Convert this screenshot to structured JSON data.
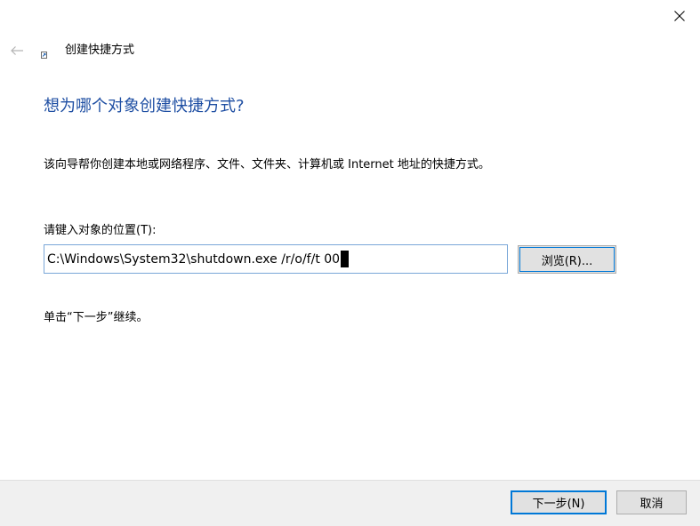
{
  "window": {
    "close_icon": "close-icon"
  },
  "header": {
    "back_icon": "back-arrow-icon",
    "wizard_icon": "shortcut-icon",
    "title": "创建快捷方式"
  },
  "main": {
    "heading": "想为哪个对象创建快捷方式?",
    "description": "该向导帮你创建本地或网络程序、文件、文件夹、计算机或 Internet 地址的快捷方式。",
    "location_label": "请键入对象的位置(T):",
    "location_value": "C:\\Windows\\System32\\shutdown.exe /r/o/f/t 00",
    "browse_label": "浏览(R)...",
    "hint": "单击“下一步”继续。"
  },
  "footer": {
    "next_label": "下一步(N)",
    "cancel_label": "取消"
  },
  "colors": {
    "heading": "#1f4fa3",
    "input_border": "#7aa7d8",
    "focus_accent": "#0078d7",
    "footer_bg": "#f0f0f0",
    "button_bg": "#e1e1e1"
  }
}
